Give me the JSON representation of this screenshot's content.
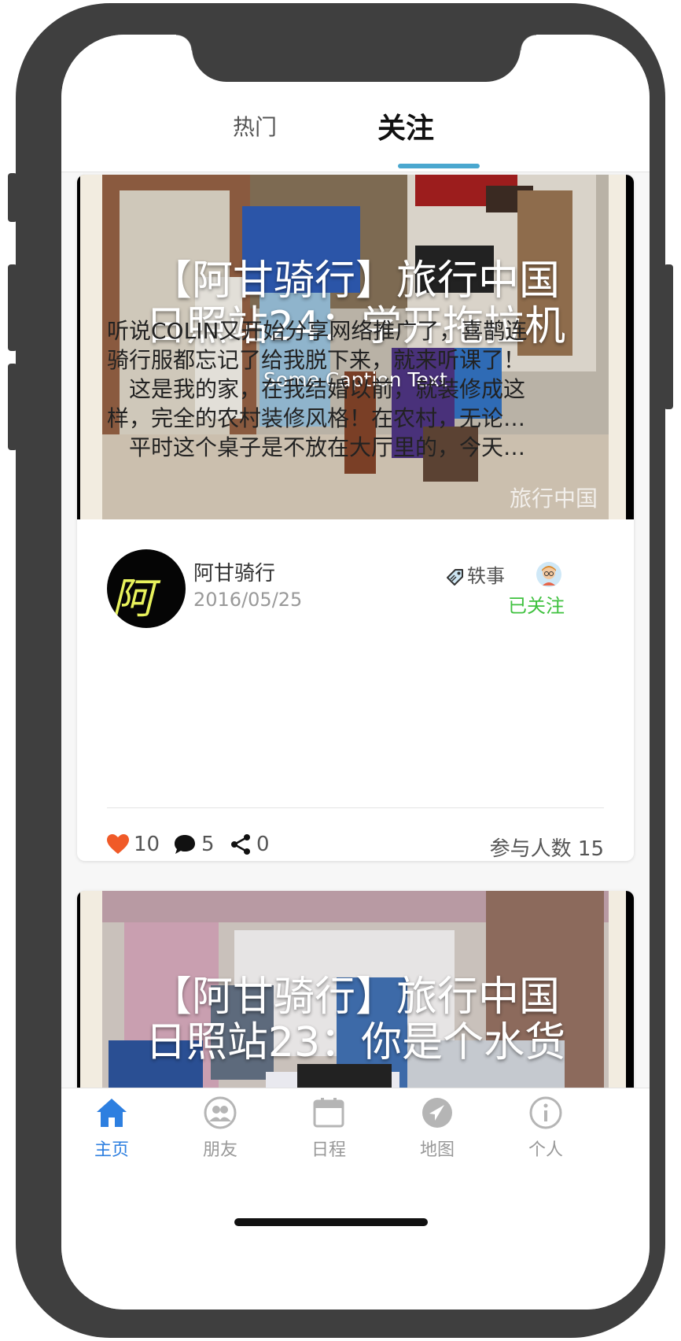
{
  "tabs": [
    {
      "label": "热门",
      "active": false
    },
    {
      "label": "关注",
      "active": true
    }
  ],
  "posts": [
    {
      "title_line1": "【阿甘骑行】旅行中国",
      "title_line2": "日照站24：学开拖拉机",
      "caption": "Some Caption Text",
      "watermark": "旅行中国",
      "author": "阿甘骑行",
      "avatar_text": "阿甘",
      "date": "2016/05/25",
      "tag": "轶事",
      "follow_status": "已关注",
      "content_lines": [
        "听说COLIN又开始分享网络推广了，喜鹊连",
        "骑行服都忘记了给我脱下来，就来听课了！",
        "　这是我的家，在我结婚以前，就装修成这",
        "样，完全的农村装修风格！在农村，无论…",
        "　平时这个桌子是不放在大厅里的，今天…"
      ],
      "likes": "10",
      "comments": "5",
      "shares": "0",
      "participants": "参与人数 15"
    },
    {
      "title_line1": "【阿甘骑行】旅行中国",
      "title_line2": "日照站23：你是个水货"
    }
  ],
  "bottom_nav": [
    {
      "label": "主页",
      "icon": "home-icon",
      "active": true
    },
    {
      "label": "朋友",
      "icon": "friends-icon",
      "active": false
    },
    {
      "label": "日程",
      "icon": "calendar-icon",
      "active": false
    },
    {
      "label": "地图",
      "icon": "map-icon",
      "active": false
    },
    {
      "label": "个人",
      "icon": "info-icon",
      "active": false
    }
  ],
  "colors": {
    "accent": "#4aa7cf",
    "nav_active": "#2d7fe0",
    "like": "#f05a28",
    "follow": "#3fc13f",
    "phone_frame": "#3f3f3f"
  }
}
